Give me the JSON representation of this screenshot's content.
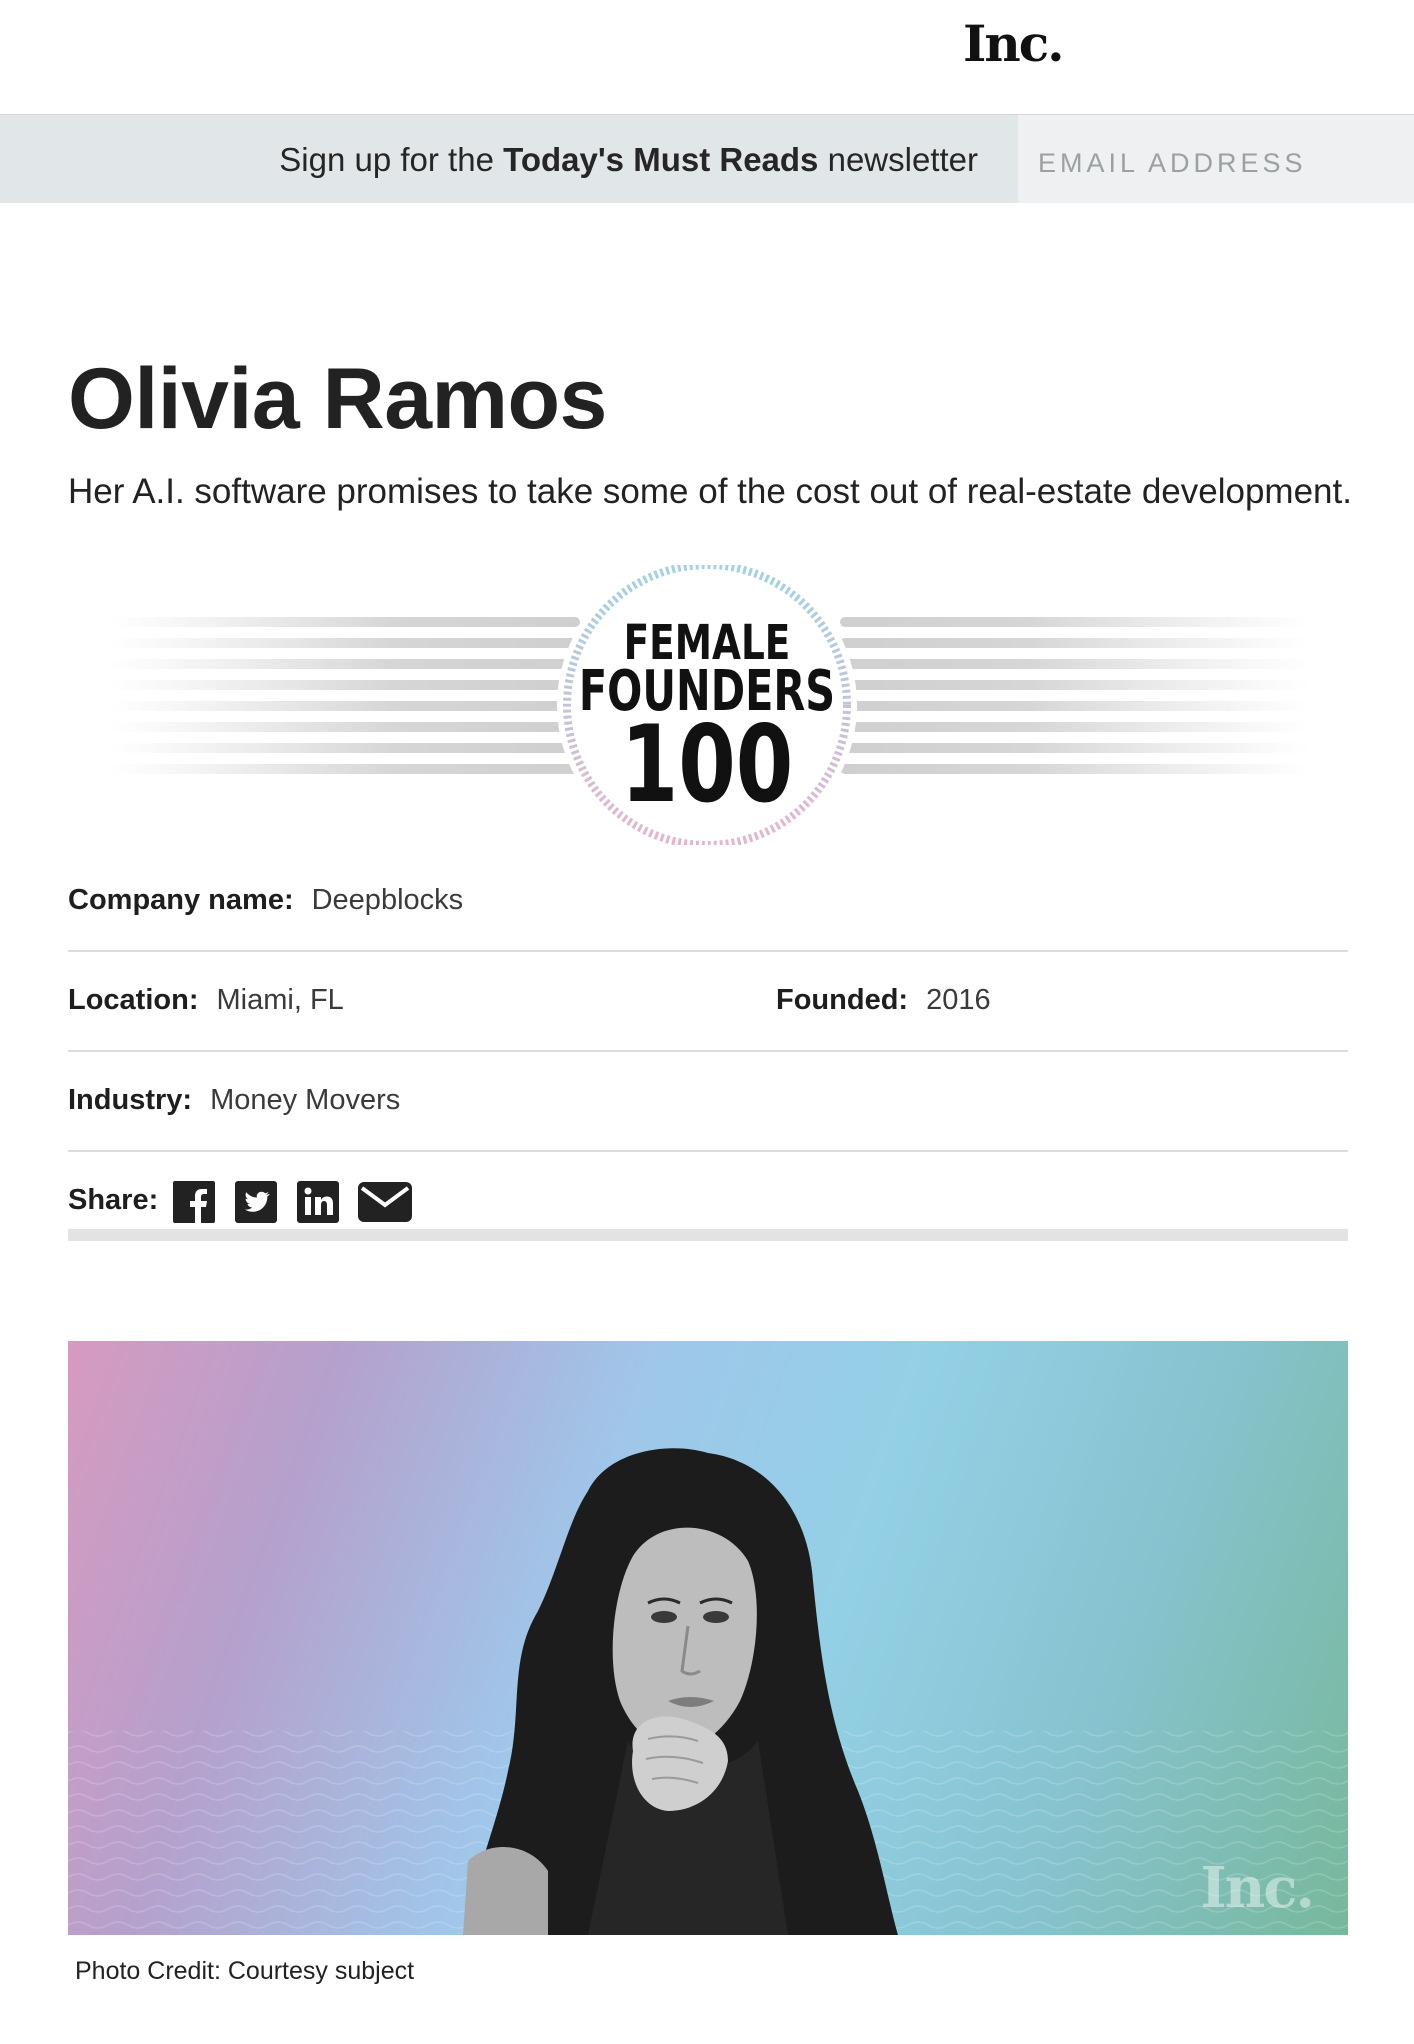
{
  "brand": {
    "logo": "Inc."
  },
  "newsletter": {
    "prefix": "Sign up for the ",
    "name": "Today's Must Reads",
    "suffix": " newsletter",
    "email_placeholder": "EMAIL ADDRESS"
  },
  "profile": {
    "name": "Olivia Ramos",
    "tagline": "Her A.I. software promises to take some of the cost out of real-estate development."
  },
  "badge": {
    "line1": "FEMALE",
    "line2": "FOUNDERS",
    "line3": "100"
  },
  "details": {
    "company_label": "Company name:",
    "company_value": "Deepblocks",
    "location_label": "Location:",
    "location_value": "Miami, FL",
    "founded_label": "Founded:",
    "founded_value": "2016",
    "industry_label": "Industry:",
    "industry_value": "Money Movers"
  },
  "share": {
    "label": "Share:",
    "icons": [
      "facebook-icon",
      "twitter-icon",
      "linkedin-icon",
      "email-icon"
    ]
  },
  "photo": {
    "watermark": "Inc.",
    "credit": "Photo Credit: Courtesy subject"
  },
  "colors": {
    "newsletter_bg": "#e1e7e9",
    "email_bg": "#eef0f1",
    "photo_gradient_start": "#d79ac0",
    "photo_gradient_mid": "#93d0e6",
    "photo_gradient_end": "#77b89b"
  }
}
